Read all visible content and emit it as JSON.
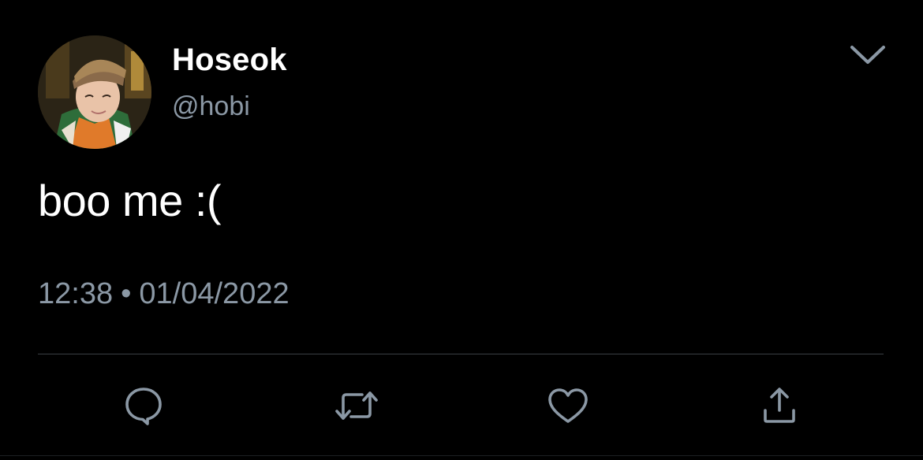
{
  "tweet": {
    "author": {
      "display_name": "Hoseok",
      "handle": "@hobi"
    },
    "text": "boo me :(",
    "time": "12:38",
    "separator": "•",
    "date": "01/04/2022"
  },
  "icons": {
    "more": "chevron-down-icon",
    "reply": "reply-icon",
    "retweet": "retweet-icon",
    "like": "heart-icon",
    "share": "share-icon"
  },
  "colors": {
    "background": "#000000",
    "text": "#ffffff",
    "secondary_text": "#8b98a5",
    "icon": "#8b98a5",
    "divider": "#3a3f44"
  }
}
